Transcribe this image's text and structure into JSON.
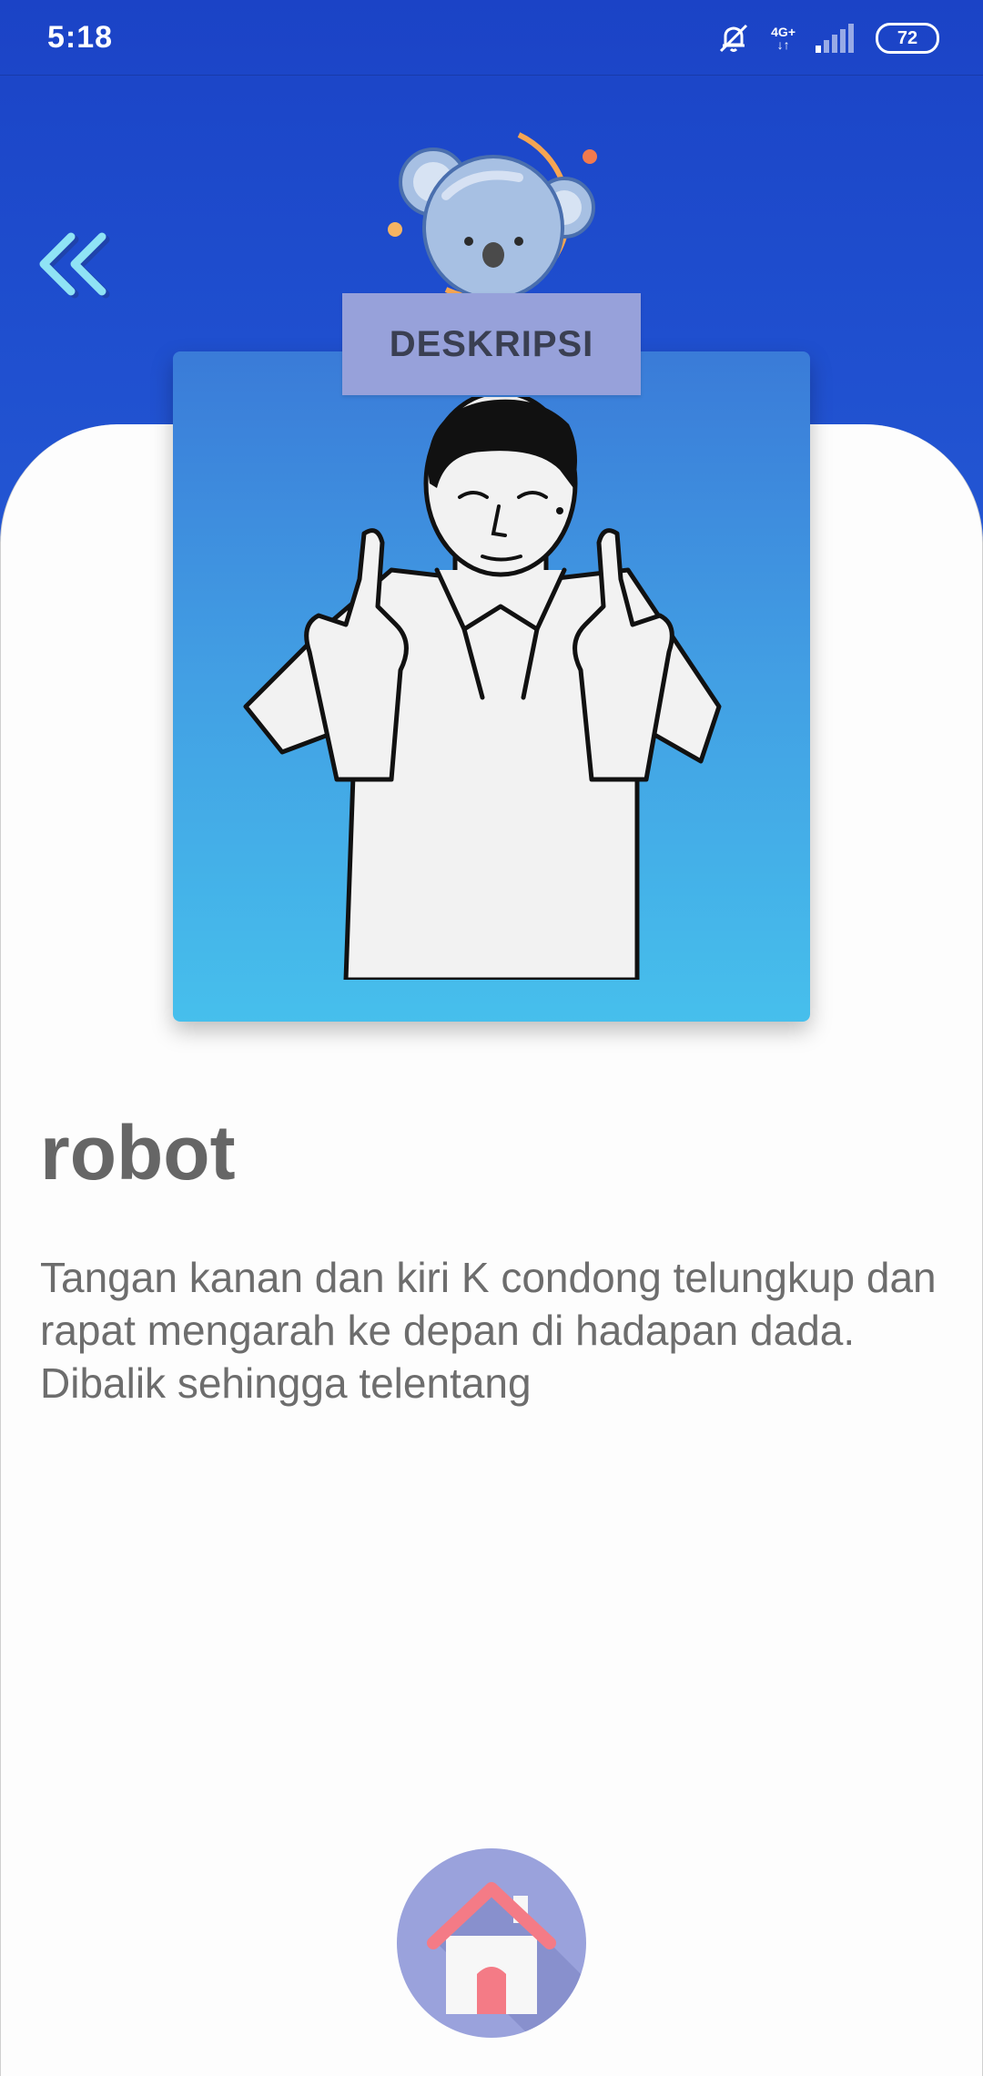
{
  "status_bar": {
    "time": "5:18",
    "network_label_top": "4G+",
    "network_label_bottom": "↓↑",
    "battery_level": "72"
  },
  "header": {
    "section_label": "DESKRIPSI"
  },
  "word": {
    "title": "robot",
    "description": "Tangan kanan dan kiri K condong telungkup dan rapat mengarah ke depan di hadapan dada. Dibalik sehingga telentang"
  },
  "icons": {
    "back": "double-chevron-left-icon",
    "home": "home-icon",
    "mascot": "koala-mascot",
    "notification": "bell-off-icon",
    "signal": "signal-bars-icon",
    "battery": "battery-icon"
  },
  "colors": {
    "header_blue": "#1b43c6",
    "label_bg": "#97a1da",
    "card_gradient_top": "#3a7bd8",
    "card_gradient_bottom": "#46bfec",
    "title_text": "#666666",
    "back_arrow": "#8fe3f5",
    "home_roof": "#f47b86"
  }
}
